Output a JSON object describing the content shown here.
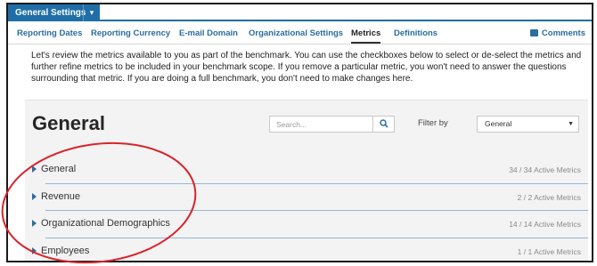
{
  "header": {
    "section_tab_label": "General Settings",
    "section_tab_caret": "▾"
  },
  "tabs": [
    {
      "label": "Reporting Dates",
      "active": false
    },
    {
      "label": "Reporting Currency",
      "active": false
    },
    {
      "label": "E-mail Domain",
      "active": false
    },
    {
      "label": "Organizational Settings",
      "active": false
    },
    {
      "label": "Metrics",
      "active": true
    },
    {
      "label": "Definitions",
      "active": false
    }
  ],
  "comments_label": "Comments",
  "intro_text": "Let's review the metrics available to you as part of the benchmark. You can use the checkboxes below to select or de-select the metrics and further refine metrics to be included in your benchmark scope. If you remove a particular metric, you won't need to answer the questions surrounding that metric. If you are doing a full benchmark, you don't need to make changes here.",
  "panel": {
    "title": "General",
    "search_placeholder": "Search...",
    "filter_label": "Filter by",
    "filter_value": "General",
    "filter_caret": "▼"
  },
  "metric_groups": [
    {
      "label": "General",
      "count": "34 / 34 Active Metrics"
    },
    {
      "label": "Revenue",
      "count": "2 / 2 Active Metrics"
    },
    {
      "label": "Organizational Demographics",
      "count": "14 / 14 Active Metrics"
    },
    {
      "label": "Employees",
      "count": "1 / 1 Active Metrics"
    }
  ],
  "colors": {
    "accent": "#1f6ea8",
    "link": "#2a6d9e",
    "annotation": "#d8232a"
  }
}
